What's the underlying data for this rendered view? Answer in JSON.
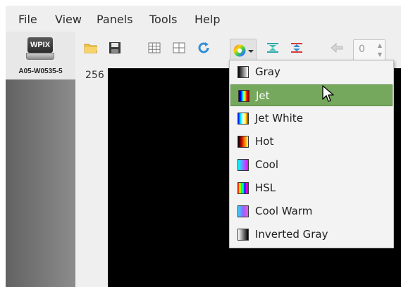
{
  "menubar": {
    "items": [
      "File",
      "View",
      "Panels",
      "Tools",
      "Help"
    ]
  },
  "device": {
    "badge": "WPIX",
    "id": "A05-W0535-5"
  },
  "toolbar": {
    "icons": [
      "folder-open-icon",
      "save-icon",
      "grid-icon",
      "split-view-icon",
      "refresh-icon",
      "colormap-icon",
      "fit-range-icon",
      "invert-range-icon",
      "back-arrow-icon"
    ],
    "spinbox_value": "0"
  },
  "ruler": {
    "top_value": "256"
  },
  "colormap_menu": {
    "selected": "Jet",
    "items": [
      {
        "label": "Gray",
        "swatch": "gray"
      },
      {
        "label": "Jet",
        "swatch": "jet"
      },
      {
        "label": "Jet White",
        "swatch": "jet-white"
      },
      {
        "label": "Hot",
        "swatch": "hot"
      },
      {
        "label": "Cool",
        "swatch": "cool"
      },
      {
        "label": "HSL",
        "swatch": "hsl"
      },
      {
        "label": "Cool Warm",
        "swatch": "cool-warm"
      },
      {
        "label": "Inverted Gray",
        "swatch": "inverted-gray"
      }
    ]
  },
  "colors": {
    "selection": "#75a85c",
    "canvas": "#000000",
    "menubar": "#efefef"
  }
}
